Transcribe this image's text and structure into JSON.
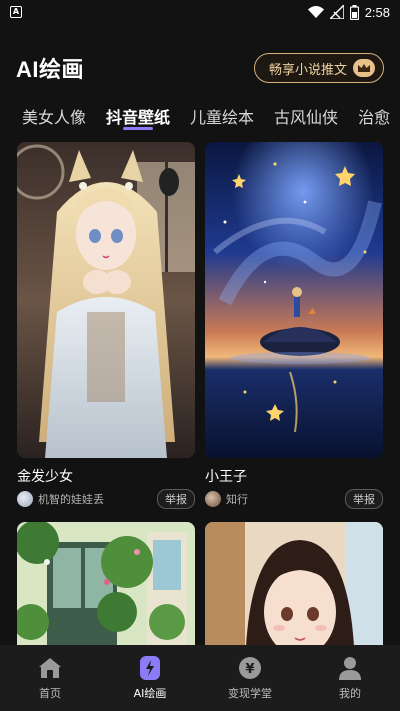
{
  "status_bar": {
    "notification_letter": "A",
    "time": "2:58",
    "icons": [
      "wifi-icon",
      "signal-icon",
      "battery-icon"
    ]
  },
  "header": {
    "title": "AI绘画",
    "vip_button_label": "畅享小说推文",
    "vip_icon": "crown-icon"
  },
  "tabs": [
    {
      "label": "美女人像",
      "active": false
    },
    {
      "label": "抖音壁纸",
      "active": true
    },
    {
      "label": "儿童绘本",
      "active": false
    },
    {
      "label": "古风仙侠",
      "active": false
    },
    {
      "label": "治愈",
      "active": false
    }
  ],
  "cards": [
    {
      "title": "金发少女",
      "author": "机智的娃娃丢",
      "report_label": "举报"
    },
    {
      "title": "小王子",
      "author": "知行",
      "report_label": "举报"
    },
    {
      "title": "",
      "author": "",
      "report_label": ""
    },
    {
      "title": "",
      "author": "",
      "report_label": ""
    }
  ],
  "bottom_nav": [
    {
      "label": "首页",
      "icon": "home-icon",
      "active": false
    },
    {
      "label": "AI绘画",
      "icon": "ai-brush-icon",
      "active": true
    },
    {
      "label": "变现学堂",
      "icon": "yen-coin-icon",
      "active": false
    },
    {
      "label": "我的",
      "icon": "profile-icon",
      "active": false
    }
  ],
  "colors": {
    "background": "#121212",
    "accent_purple": "#8b7cf6",
    "vip_gold": "#d8b07a",
    "nav_background": "#1c1c1c"
  }
}
